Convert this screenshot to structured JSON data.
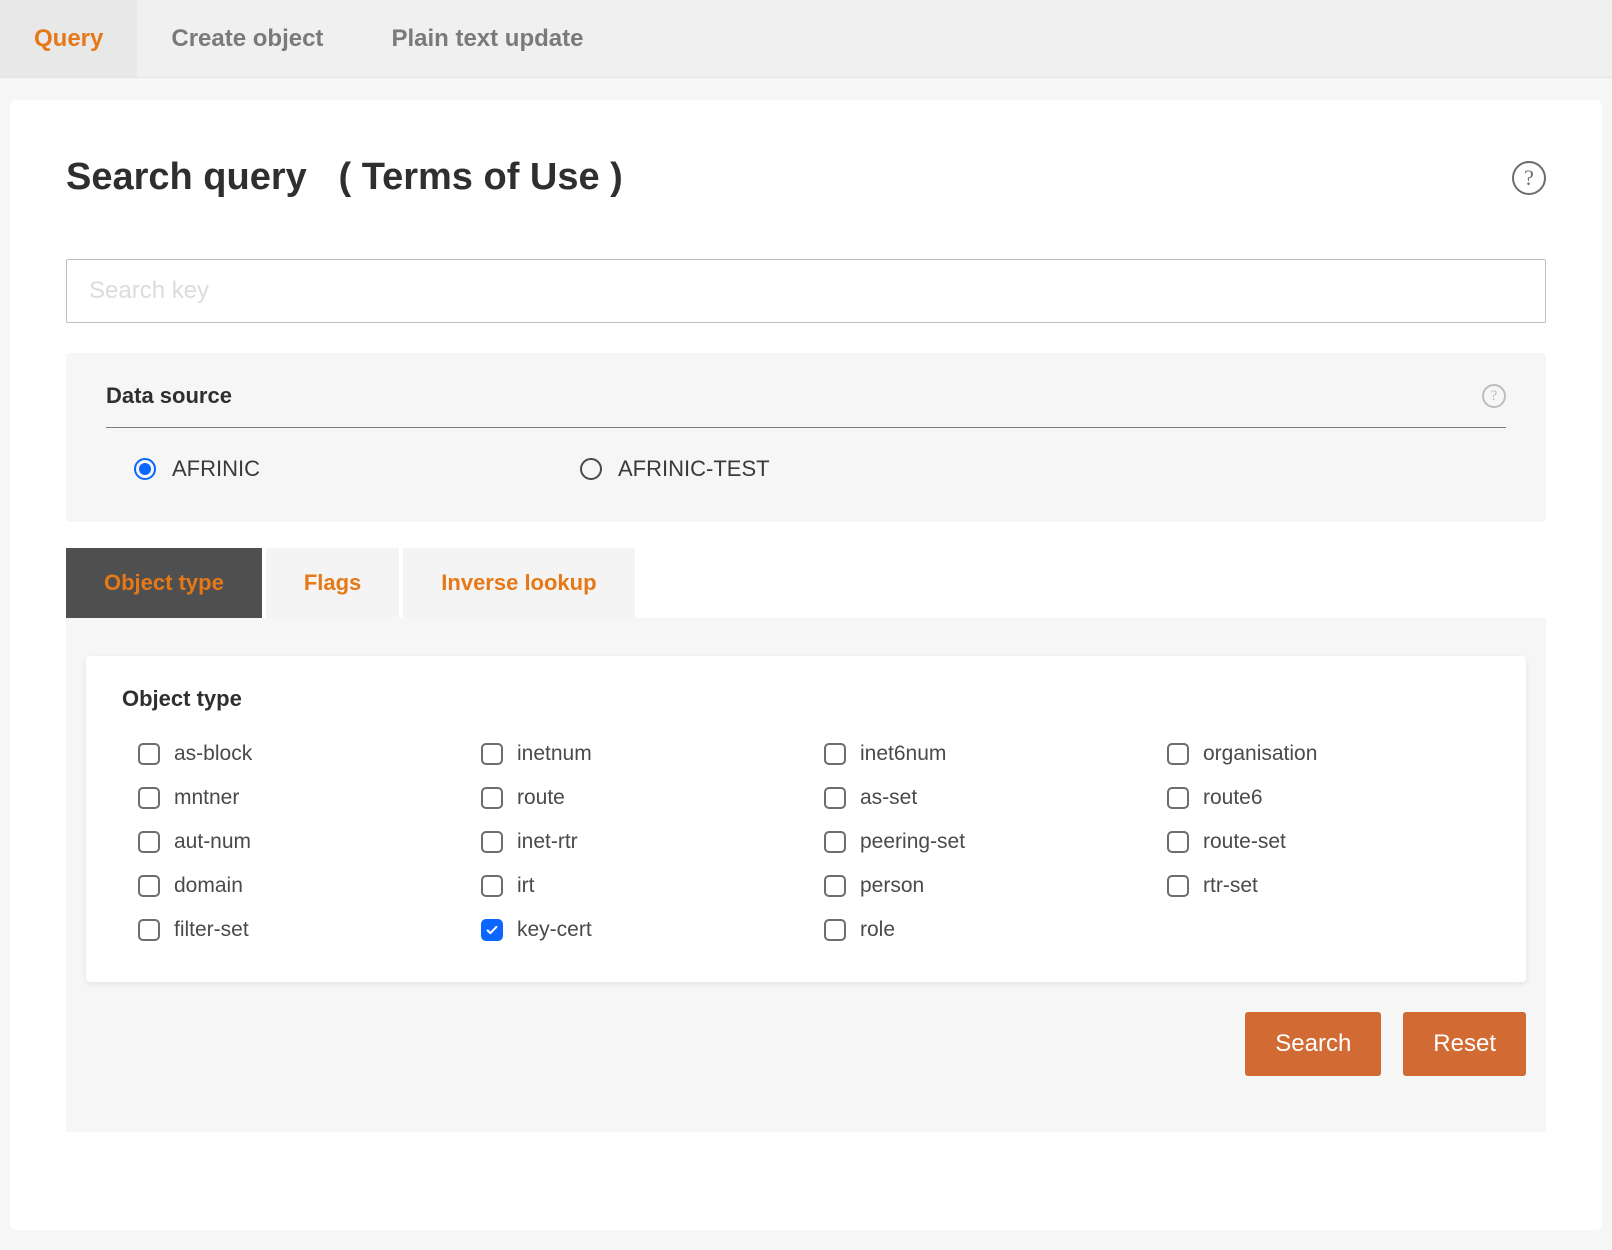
{
  "top_tabs": {
    "query": "Query",
    "create_object": "Create object",
    "plain_text_update": "Plain text update",
    "active": "query"
  },
  "title": {
    "main": "Search query",
    "terms": "( Terms of Use )"
  },
  "search": {
    "placeholder": "Search key",
    "value": ""
  },
  "data_source": {
    "label": "Data source",
    "options": [
      {
        "id": "afrinic",
        "label": "AFRINIC",
        "selected": true
      },
      {
        "id": "afrinic-test",
        "label": "AFRINIC-TEST",
        "selected": false
      }
    ]
  },
  "sub_tabs": {
    "object_type": "Object type",
    "flags": "Flags",
    "inverse_lookup": "Inverse lookup",
    "active": "object_type"
  },
  "object_type_panel": {
    "heading": "Object type",
    "columns": [
      [
        {
          "id": "as-block",
          "label": "as-block",
          "checked": false
        },
        {
          "id": "mntner",
          "label": "mntner",
          "checked": false
        },
        {
          "id": "aut-num",
          "label": "aut-num",
          "checked": false
        },
        {
          "id": "domain",
          "label": "domain",
          "checked": false
        },
        {
          "id": "filter-set",
          "label": "filter-set",
          "checked": false
        }
      ],
      [
        {
          "id": "inetnum",
          "label": "inetnum",
          "checked": false
        },
        {
          "id": "route",
          "label": "route",
          "checked": false
        },
        {
          "id": "inet-rtr",
          "label": "inet-rtr",
          "checked": false
        },
        {
          "id": "irt",
          "label": "irt",
          "checked": false
        },
        {
          "id": "key-cert",
          "label": "key-cert",
          "checked": true
        }
      ],
      [
        {
          "id": "inet6num",
          "label": "inet6num",
          "checked": false
        },
        {
          "id": "as-set",
          "label": "as-set",
          "checked": false
        },
        {
          "id": "peering-set",
          "label": "peering-set",
          "checked": false
        },
        {
          "id": "person",
          "label": "person",
          "checked": false
        },
        {
          "id": "role",
          "label": "role",
          "checked": false
        }
      ],
      [
        {
          "id": "organisation",
          "label": "organisation",
          "checked": false
        },
        {
          "id": "route6",
          "label": "route6",
          "checked": false
        },
        {
          "id": "route-set",
          "label": "route-set",
          "checked": false
        },
        {
          "id": "rtr-set",
          "label": "rtr-set",
          "checked": false
        }
      ]
    ]
  },
  "buttons": {
    "search": "Search",
    "reset": "Reset"
  },
  "icons": {
    "help": "?",
    "help_small": "?"
  }
}
